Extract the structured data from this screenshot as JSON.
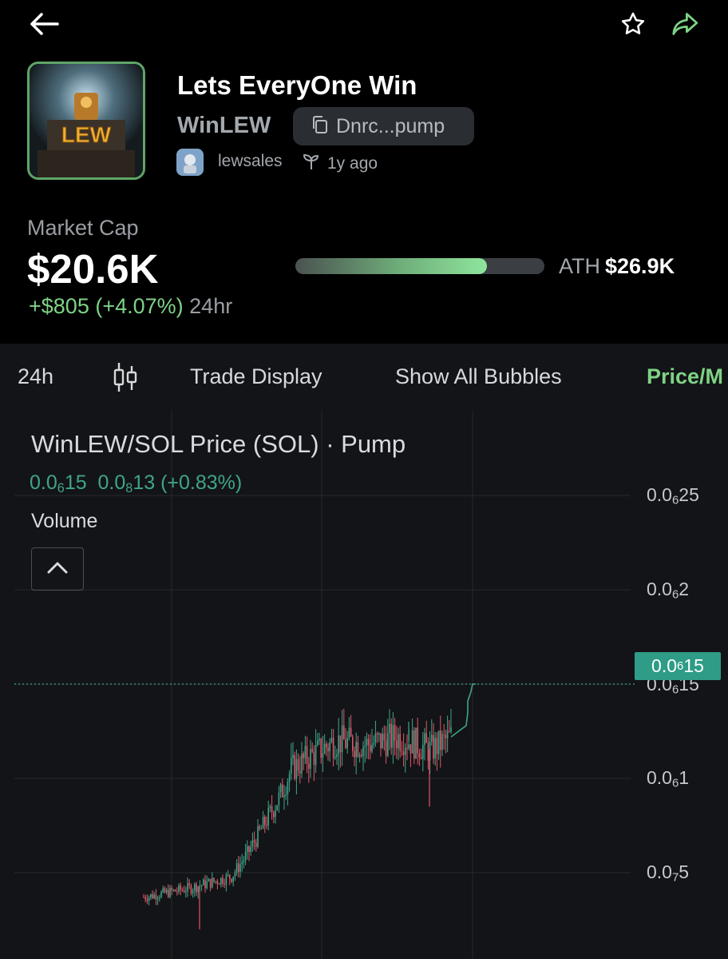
{
  "header": {
    "token_name": "Lets EveryOne Win",
    "ticker": "WinLEW",
    "address_short": "Dnrc...pump",
    "creator": "lewsales",
    "age": "1y ago",
    "logo_text": "LEW"
  },
  "market": {
    "label": "Market Cap",
    "value": "$20.6K",
    "change": "+$805 (+4.07%)",
    "period": "24hr",
    "ath_label": "ATH",
    "ath_value": "$26.9K",
    "progress_fraction": 0.77
  },
  "toolbar": {
    "interval": "24h",
    "trade_display": "Trade Display",
    "show_bubbles": "Show All Bubbles",
    "price_toggle": "Price/M"
  },
  "chart": {
    "pair_title": "WinLEW/SOL Price (SOL) · Pump",
    "volume_label": "Volume",
    "ohlc_parts": [
      {
        "main": "0.0",
        "sub": "6",
        "rest": "15"
      },
      {
        "main": "0.0",
        "sub": "8",
        "rest": "13 (+0.83%)"
      }
    ],
    "y_ticks": [
      {
        "main": "0.0",
        "sub": "6",
        "rest": "25"
      },
      {
        "main": "0.0",
        "sub": "6",
        "rest": "2"
      },
      {
        "main": "0.0",
        "sub": "6",
        "rest": "15"
      },
      {
        "main": "0.0",
        "sub": "6",
        "rest": "1"
      },
      {
        "main": "0.0",
        "sub": "7",
        "rest": "5"
      }
    ],
    "current_price": {
      "main": "0.0",
      "sub": "6",
      "rest": "15"
    }
  },
  "colors": {
    "up": "#3fa58a",
    "down": "#e0586a",
    "accent_green": "#7ed385",
    "border_green": "#5fa567"
  },
  "chart_data": {
    "type": "candlestick",
    "y_unit": "SOL",
    "series_note_values_in_SOL": true,
    "ylim": [
      3e-07,
      2.8e-06
    ],
    "y_tick_values": [
      2.5e-06,
      2e-06,
      1.5e-06,
      1e-06,
      5e-07
    ],
    "current_price": 1.5e-06,
    "change_pct": 0.83
  }
}
